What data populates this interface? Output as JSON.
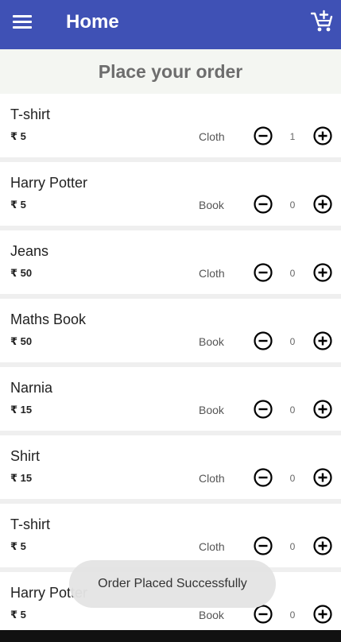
{
  "appbar": {
    "title": "Home",
    "menu_icon": "menu-icon",
    "cart_icon": "add-shopping-cart-icon",
    "color": "#3f51b5"
  },
  "page": {
    "heading": "Place your order"
  },
  "items": [
    {
      "name": "T-shirt",
      "price": "₹ 5",
      "category": "Cloth",
      "quantity": "1"
    },
    {
      "name": "Harry Potter",
      "price": "₹ 5",
      "category": "Book",
      "quantity": "0"
    },
    {
      "name": "Jeans",
      "price": "₹ 50",
      "category": "Cloth",
      "quantity": "0"
    },
    {
      "name": "Maths Book",
      "price": "₹ 50",
      "category": "Book",
      "quantity": "0"
    },
    {
      "name": "Narnia",
      "price": "₹ 15",
      "category": "Book",
      "quantity": "0"
    },
    {
      "name": "Shirt",
      "price": "₹ 15",
      "category": "Cloth",
      "quantity": "0"
    },
    {
      "name": "T-shirt",
      "price": "₹ 5",
      "category": "Cloth",
      "quantity": "0"
    },
    {
      "name": "Harry Potter",
      "price": "₹ 5",
      "category": "Book",
      "quantity": "0"
    }
  ],
  "item_icons": {
    "decrease": "remove-circle-icon",
    "increase": "add-circle-icon"
  },
  "toast": {
    "message": "Order Placed Successfully"
  }
}
